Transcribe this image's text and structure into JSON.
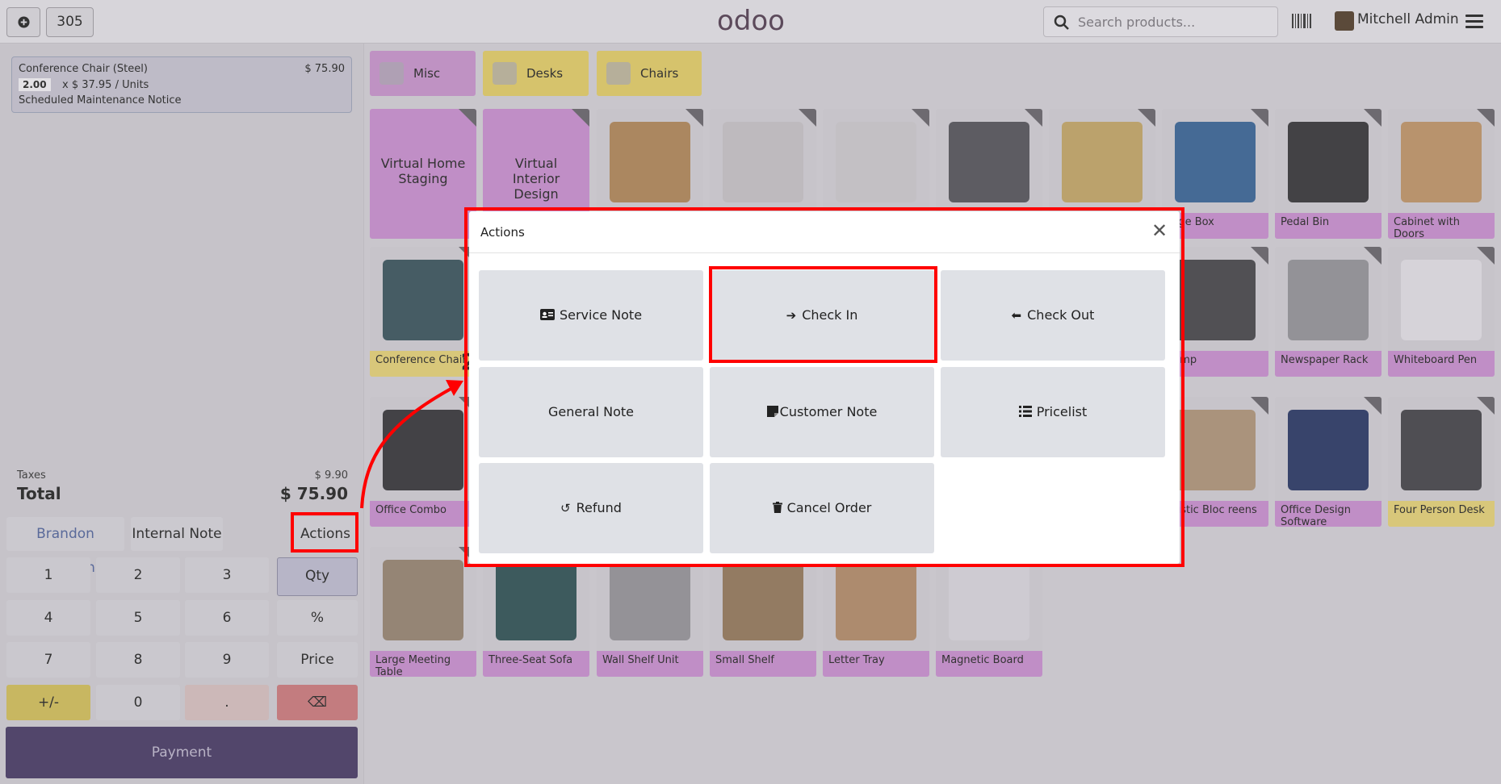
{
  "topbar": {
    "new_order_icon": "plus-circle-icon",
    "order_number": "305",
    "logo": "odoo",
    "search_placeholder": "Search products...",
    "user_name": "Mitchell Admin"
  },
  "order": {
    "line": {
      "name": "Conference Chair (Steel)",
      "price": "$ 75.90",
      "qty": "2.00",
      "unit": "x $ 37.95 / Units",
      "note": "Scheduled Maintenance Notice"
    },
    "taxes_label": "Taxes",
    "taxes_value": "$ 9.90",
    "total_label": "Total",
    "total_value": "$ 75.90"
  },
  "controls": {
    "customer": "Brandon Freeman",
    "internal_note": "Internal Note",
    "actions": "Actions"
  },
  "numpad": {
    "k1": "1",
    "k2": "2",
    "k3": "3",
    "qty": "Qty",
    "k4": "4",
    "k5": "5",
    "k6": "6",
    "percent": "%",
    "k7": "7",
    "k8": "8",
    "k9": "9",
    "price": "Price",
    "plusminus": "+/-",
    "k0": "0",
    "dot": ".",
    "backspace": "⌫"
  },
  "payment": "Payment",
  "categories": {
    "misc": "Misc",
    "desks": "Desks",
    "chairs": "Chairs"
  },
  "products": {
    "p1": "Virtual Home Staging",
    "p2": "Virtual Interior Design",
    "p3": "rage Box",
    "p4": "Pedal Bin",
    "p5": "Cabinet with Doors",
    "p6": "Conference Chair",
    "p7": "Lamp",
    "p8": "Newspaper Rack",
    "p9": "Whiteboard Pen",
    "p10": "Office Combo",
    "p11": "oustic Bloc reens",
    "p12": "Office Design Software",
    "p13": "Four Person Desk",
    "p14": "Large Meeting Table",
    "p15": "Three-Seat Sofa",
    "p16": "Wall Shelf Unit",
    "p17": "Small Shelf",
    "p18": "Letter Tray",
    "p19": "Magnetic Board",
    "badge_conference": "2"
  },
  "modal": {
    "title": "Actions",
    "buttons": {
      "service_note": "Service Note",
      "check_in": "Check In",
      "check_out": "Check Out",
      "general_note": "General Note",
      "customer_note": "Customer Note",
      "pricelist": "Pricelist",
      "refund": "Refund",
      "cancel_order": "Cancel Order"
    }
  }
}
